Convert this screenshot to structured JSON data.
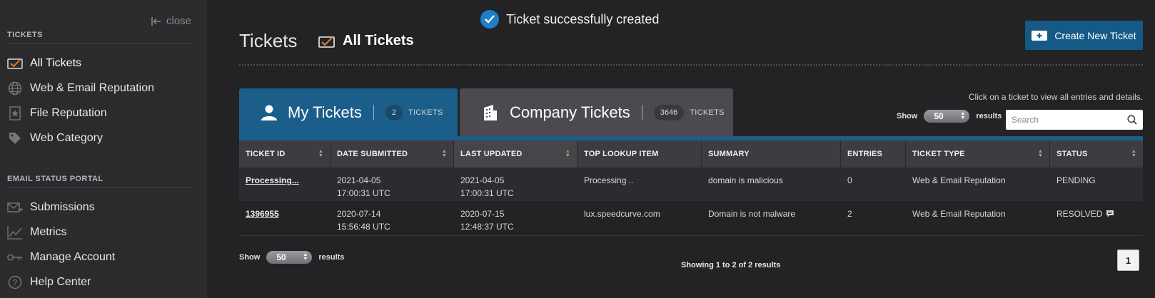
{
  "sidebar": {
    "close_label": "close",
    "sections": [
      {
        "heading": "TICKETS",
        "items": [
          {
            "label": "All Tickets",
            "icon": "ticket-check-icon",
            "active": true
          },
          {
            "label": "Web & Email Reputation",
            "icon": "globe-icon"
          },
          {
            "label": "File Reputation",
            "icon": "file-star-icon"
          },
          {
            "label": "Web Category",
            "icon": "tag-icon"
          }
        ]
      },
      {
        "heading": "EMAIL STATUS PORTAL",
        "items": [
          {
            "label": "Submissions",
            "icon": "envelope-arrow-icon"
          },
          {
            "label": "Metrics",
            "icon": "line-chart-icon"
          },
          {
            "label": "Manage Account",
            "icon": "key-icon"
          },
          {
            "label": "Help Center",
            "icon": "question-circle-icon"
          }
        ]
      }
    ]
  },
  "header": {
    "title": "Tickets",
    "subtitle": "All Tickets",
    "toast": "Ticket successfully created",
    "create_button": "Create New Ticket"
  },
  "tabs": [
    {
      "label": "My Tickets",
      "count": "2",
      "unit": "TICKETS",
      "icon": "user-icon"
    },
    {
      "label": "Company Tickets",
      "count": "3646",
      "unit": "TICKETS",
      "icon": "building-icon"
    }
  ],
  "controls": {
    "hint": "Click on a ticket to view all entries and details.",
    "show_label": "Show",
    "show_value": "50",
    "results_label": "results",
    "search_placeholder": "Search"
  },
  "table": {
    "columns": [
      "TICKET ID",
      "DATE SUBMITTED",
      "LAST UPDATED",
      "TOP LOOKUP ITEM",
      "SUMMARY",
      "ENTRIES",
      "TICKET TYPE",
      "STATUS"
    ],
    "rows": [
      {
        "ticket_id": "Processing...",
        "date_submitted": "2021-04-05",
        "date_submitted_time": "17:00:31 UTC",
        "last_updated": "2021-04-05",
        "last_updated_time": "17:00:31 UTC",
        "top_lookup": "Processing ..",
        "summary": "domain is malicious",
        "entries": "0",
        "ticket_type": "Web & Email Reputation",
        "status": "PENDING"
      },
      {
        "ticket_id": "1396955",
        "date_submitted": "2020-07-14",
        "date_submitted_time": "15:56:48 UTC",
        "last_updated": "2020-07-15",
        "last_updated_time": "12:48:37 UTC",
        "top_lookup": "lux.speedcurve.com",
        "summary": "Domain is not malware",
        "entries": "2",
        "ticket_type": "Web & Email Reputation",
        "status": "RESOLVED"
      }
    ]
  },
  "footer": {
    "show_label": "Show",
    "show_value": "50",
    "results_label": "results",
    "showing_text": "Showing 1 to 2 of 2 results",
    "page": "1"
  },
  "colors": {
    "accent": "#1b5e8a",
    "sort_active": "#e07b22",
    "toast_check": "#1e7fc7"
  }
}
